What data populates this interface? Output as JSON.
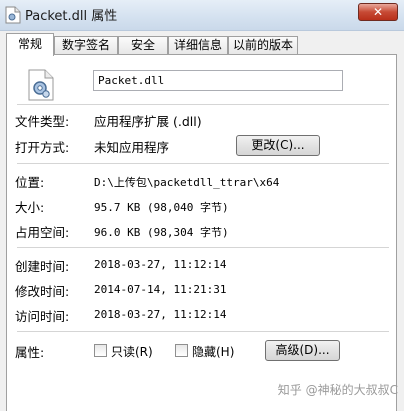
{
  "window": {
    "title": "Packet.dll 属性",
    "close_label": "✕"
  },
  "tabs": [
    {
      "label": "常规",
      "active": true
    },
    {
      "label": "数字签名",
      "active": false
    },
    {
      "label": "安全",
      "active": false
    },
    {
      "label": "详细信息",
      "active": false
    },
    {
      "label": "以前的版本",
      "active": false
    }
  ],
  "general": {
    "file_name": "Packet.dll",
    "file_type_label": "文件类型:",
    "file_type_value": "应用程序扩展 (.dll)",
    "opens_with_label": "打开方式:",
    "opens_with_value": "未知应用程序",
    "change_button": "更改(C)...",
    "location_label": "位置:",
    "location_value": "D:\\上传包\\packetdll_ttrar\\x64",
    "size_label": "大小:",
    "size_value": "95.7 KB (98,040 字节)",
    "size_on_disk_label": "占用空间:",
    "size_on_disk_value": "96.0 KB (98,304 字节)",
    "created_label": "创建时间:",
    "created_value": "2018-03-27, 11:12:14",
    "modified_label": "修改时间:",
    "modified_value": "2014-07-14, 11:21:31",
    "accessed_label": "访问时间:",
    "accessed_value": "2018-03-27, 11:12:14",
    "attributes_label": "属性:",
    "readonly_label": "只读(R)",
    "readonly_checked": false,
    "hidden_label": "隐藏(H)",
    "hidden_checked": false,
    "advanced_button": "高级(D)..."
  },
  "watermark": "知乎 @神秘的大叔叔C",
  "icons": {
    "title_icon": "document-gear-icon",
    "file_icon": "dll-gear-icon"
  }
}
